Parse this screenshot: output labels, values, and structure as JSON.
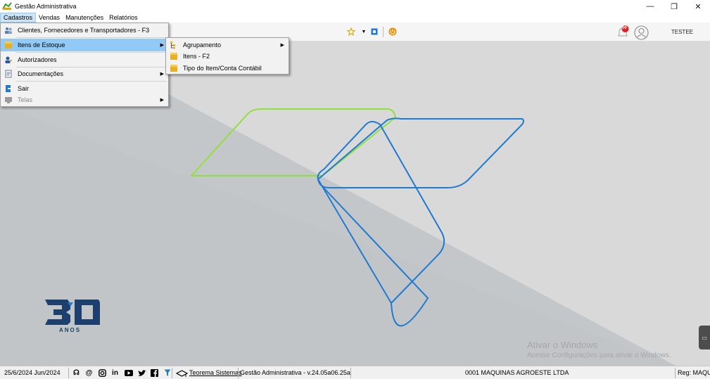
{
  "window": {
    "title": "Gestão Administrativa",
    "controls": [
      "—",
      "❐",
      "✕"
    ]
  },
  "menubar": {
    "items": [
      "Cadastros",
      "Vendas",
      "Manutenções",
      "Relatórios"
    ]
  },
  "toolbar": {
    "user": "TESTEE",
    "notification_count": "00"
  },
  "cadastros_menu": {
    "items": [
      {
        "label": "Clientes, Fornecedores e Transportadores - F3",
        "icon": "people-icon"
      },
      {
        "label": "Itens de Estoque",
        "icon": "box-icon",
        "submenu": true
      },
      {
        "label": "Autorizadores",
        "icon": "user-key-icon"
      },
      {
        "label": "Documentações",
        "icon": "document-icon",
        "submenu": true
      },
      {
        "label": "Sair",
        "icon": "exit-icon"
      },
      {
        "label": "Telas",
        "icon": "screen-icon",
        "submenu": true
      }
    ]
  },
  "estoque_submenu": {
    "items": [
      {
        "label": "Agrupamento",
        "icon": "tree-icon",
        "submenu": true
      },
      {
        "label": "Itens - F2",
        "icon": "box-icon"
      },
      {
        "label": "Tipo do Item/Conta Contábil",
        "icon": "box-icon"
      }
    ]
  },
  "logo": {
    "number": "30",
    "text": "ANOS"
  },
  "watermark": {
    "line1": "Ativar o Windows",
    "line2": "Acesse Configurações para ativar o Windows."
  },
  "statusbar": {
    "date": "25/6/2024 Jun/2024",
    "company_link": "Teorema Sistemas",
    "version": "Gestão Administrativa - v.24.05a06.25a",
    "company": "0001 MAQUINAS AGROESTE LTDA",
    "reg": "Reg: MAQU"
  },
  "colors": {
    "accent_green": "#8fe13a",
    "accent_blue": "#1f7ad1",
    "menu_highlight": "#91c9f7"
  }
}
